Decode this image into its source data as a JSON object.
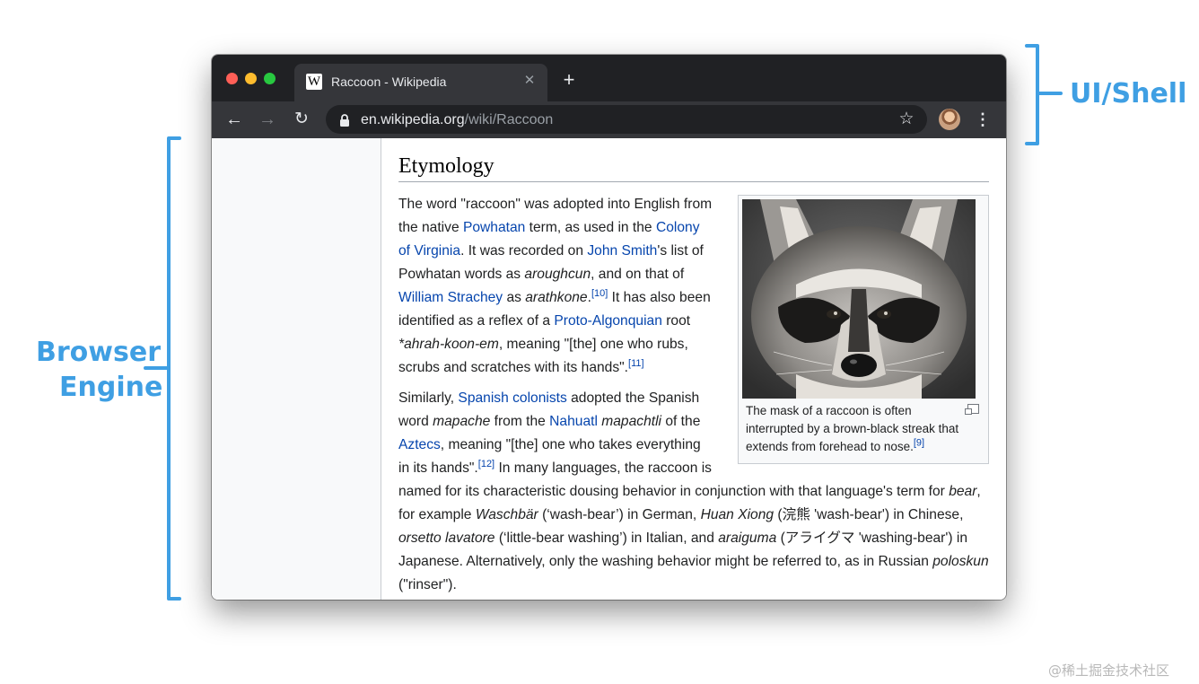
{
  "tab": {
    "title": "Raccoon - Wikipedia",
    "favicon": "W",
    "close": "✕"
  },
  "new_tab": "+",
  "nav": {
    "back": "←",
    "forward": "→",
    "reload": "↻"
  },
  "address": {
    "host": "en.wikipedia.org",
    "path": "/wiki/Raccoon"
  },
  "bookmark_star": "☆",
  "menu": "⋮",
  "article": {
    "heading": "Etymology",
    "p1": [
      {
        "t": "The word \"raccoon\" was adopted into English from the native "
      },
      {
        "t": "Powhatan",
        "link": true
      },
      {
        "t": " term, as used in the "
      },
      {
        "t": "Colony of Virginia",
        "link": true
      },
      {
        "t": ". It was recorded on "
      },
      {
        "t": "John Smith",
        "link": true
      },
      {
        "t": "'s list of Powhatan words as "
      },
      {
        "t": "aroughcun",
        "italic": true
      },
      {
        "t": ", and on that of "
      },
      {
        "t": "William Strachey",
        "link": true
      },
      {
        "t": " as "
      },
      {
        "t": "arathkone",
        "italic": true
      },
      {
        "t": "."
      },
      {
        "t": "[10]",
        "sup": true
      },
      {
        "t": " It has also been identified as a reflex of a "
      },
      {
        "t": "Proto-Algonquian",
        "link": true
      },
      {
        "t": " root "
      },
      {
        "t": "*ahrah-koon-em",
        "italic": true
      },
      {
        "t": ", meaning \"[the] one who rubs, scrubs and scratches with its hands\"."
      },
      {
        "t": "[11]",
        "sup": true
      }
    ],
    "p2": [
      {
        "t": "Similarly, "
      },
      {
        "t": "Spanish colonists",
        "link": true
      },
      {
        "t": " adopted the Spanish word "
      },
      {
        "t": "mapache",
        "italic": true
      },
      {
        "t": " from the "
      },
      {
        "t": "Nahuatl",
        "link": true
      },
      {
        "t": " "
      },
      {
        "t": "mapachtli",
        "italic": true
      },
      {
        "t": " of the "
      },
      {
        "t": "Aztecs",
        "link": true
      },
      {
        "t": ", meaning \"[the] one who takes everything in its hands\"."
      },
      {
        "t": "[12]",
        "sup": true
      },
      {
        "t": " In many languages, the raccoon is named for its characteristic dousing behavior in conjunction with that language's term for "
      },
      {
        "t": "bear",
        "italic": true
      },
      {
        "t": ", for example "
      },
      {
        "t": "Waschbär",
        "italic": true
      },
      {
        "t": " (‘wash-bear’) in German, "
      },
      {
        "t": "Huan Xiong",
        "italic": true
      },
      {
        "t": " (浣熊 'wash-bear') in Chinese, "
      },
      {
        "t": "orsetto lavatore",
        "italic": true
      },
      {
        "t": " (‘little-bear washing’) in Italian, and "
      },
      {
        "t": "araiguma",
        "italic": true
      },
      {
        "t": " (アライグマ 'washing-bear') in Japanese. Alternatively, only the washing behavior might be referred to, as in Russian "
      },
      {
        "t": "poloskun",
        "italic": true
      },
      {
        "t": " (\"rinser\")."
      }
    ],
    "figure": {
      "caption": "The mask of a raccoon is often interrupted by a brown-black streak that extends from forehead to nose.",
      "caption_ref": "[9]"
    }
  },
  "annotations": {
    "shell": "UI/Shell",
    "engine_line1": "Browser",
    "engine_line2": "Engine"
  },
  "watermark": "@稀土掘金技术社区",
  "colors": {
    "bracket": "#3f9fe3",
    "tabbar": "#202124",
    "toolbar": "#35363a",
    "link": "#0645ad"
  }
}
